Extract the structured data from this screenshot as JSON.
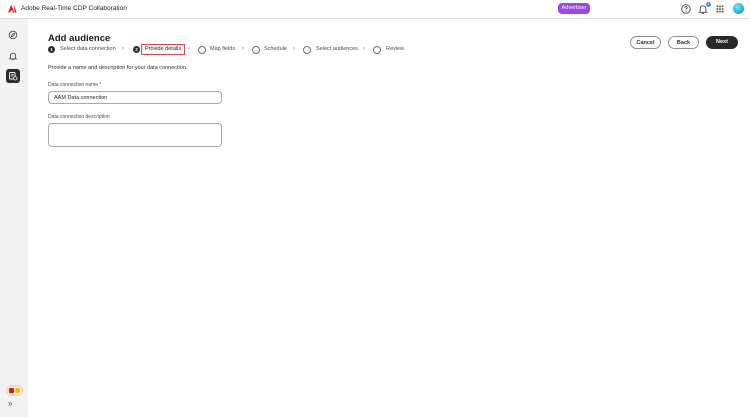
{
  "topbar": {
    "app_title": "Adobe Real-Time CDP Collaboration",
    "role_badge": "Advertiser",
    "notification_count": "1",
    "icons": [
      "help-icon",
      "bell-icon",
      "app-grid-icon",
      "avatar"
    ]
  },
  "sidebar": {
    "items": [
      {
        "icon": "compass-icon",
        "active": false
      },
      {
        "icon": "bell-outline-icon",
        "active": false
      },
      {
        "icon": "data-connections-icon",
        "active": true
      }
    ],
    "bottom_icons": [
      "app-tray-icon",
      "expand-sidebar-icon"
    ]
  },
  "page": {
    "title": "Add audience",
    "steps": [
      {
        "number": "1",
        "label": "Select data connection",
        "state": "done"
      },
      {
        "number": "2",
        "label": "Provide details",
        "state": "current"
      },
      {
        "label": "Map fields",
        "state": "pending"
      },
      {
        "label": "Schedule",
        "state": "pending"
      },
      {
        "label": "Select audiences",
        "state": "pending"
      },
      {
        "label": "Review",
        "state": "pending"
      }
    ],
    "buttons": {
      "cancel": "Cancel",
      "back": "Back",
      "next": "Next"
    },
    "description": "Provide a name and description for your data connection.",
    "fields": {
      "name_label": "Data connection name",
      "name_required_mark": "*",
      "name_value": "AAM Data connection",
      "description_label": "Data connection description",
      "description_value": ""
    }
  },
  "colors": {
    "accent_purple": "#9a47e8",
    "current_step_outline": "#e34850",
    "primary_button": "#292929"
  }
}
